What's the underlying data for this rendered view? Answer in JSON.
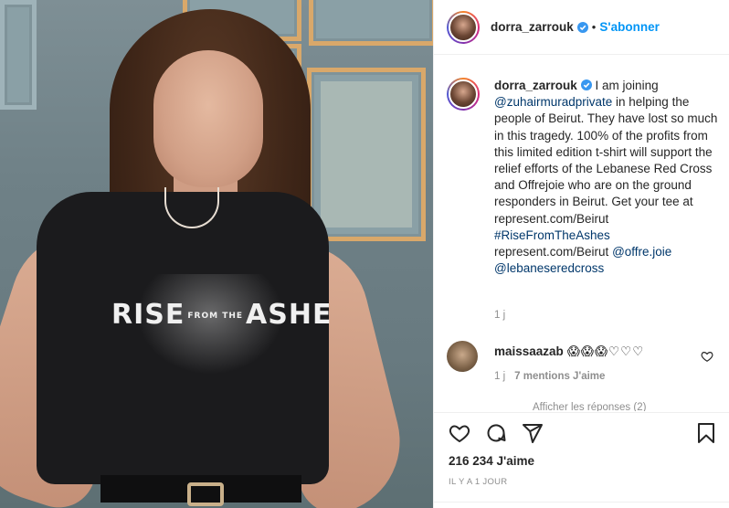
{
  "post": {
    "username": "dorra_zarrouk",
    "follow_label": "S'abonner",
    "separator": "•",
    "caption": {
      "author": "dorra_zarrouk",
      "text_before": " I am joining ",
      "mention_1": "@zuhairmuradprivate",
      "text_middle": " in helping the people of Beirut. They have lost so much in this tragedy. 100% of the profits from this limited edition t-shirt will support the relief efforts of the Lebanese Red Cross and Offrejoie who are on the ground responders in Beirut. Get your tee at represent.com/Beirut ",
      "hashtag": "#RiseFromTheAshes",
      "text_after": " represent.com/Beirut ",
      "mention_2": "@offre.joie",
      "mention_3": "@lebaneseredcross",
      "time": "1 j"
    },
    "comment": {
      "username": "maissaazab",
      "emojis": "😱😱😱♡♡♡",
      "time": "1 j",
      "likes": "7 mentions J'aime",
      "more_replies": "Afficher les réponses (2)"
    },
    "likes": "216 234 J'aime",
    "date": "IL Y A 1 JOUR"
  },
  "photo": {
    "shirt_text_1": "RISE",
    "shirt_text_small": "FROM THE",
    "shirt_text_2": "ASHE"
  },
  "colors": {
    "accent": "#0095f6",
    "verified": "#3897f0",
    "text": "#262626",
    "muted": "#8e8e8e",
    "link": "#00376b"
  }
}
